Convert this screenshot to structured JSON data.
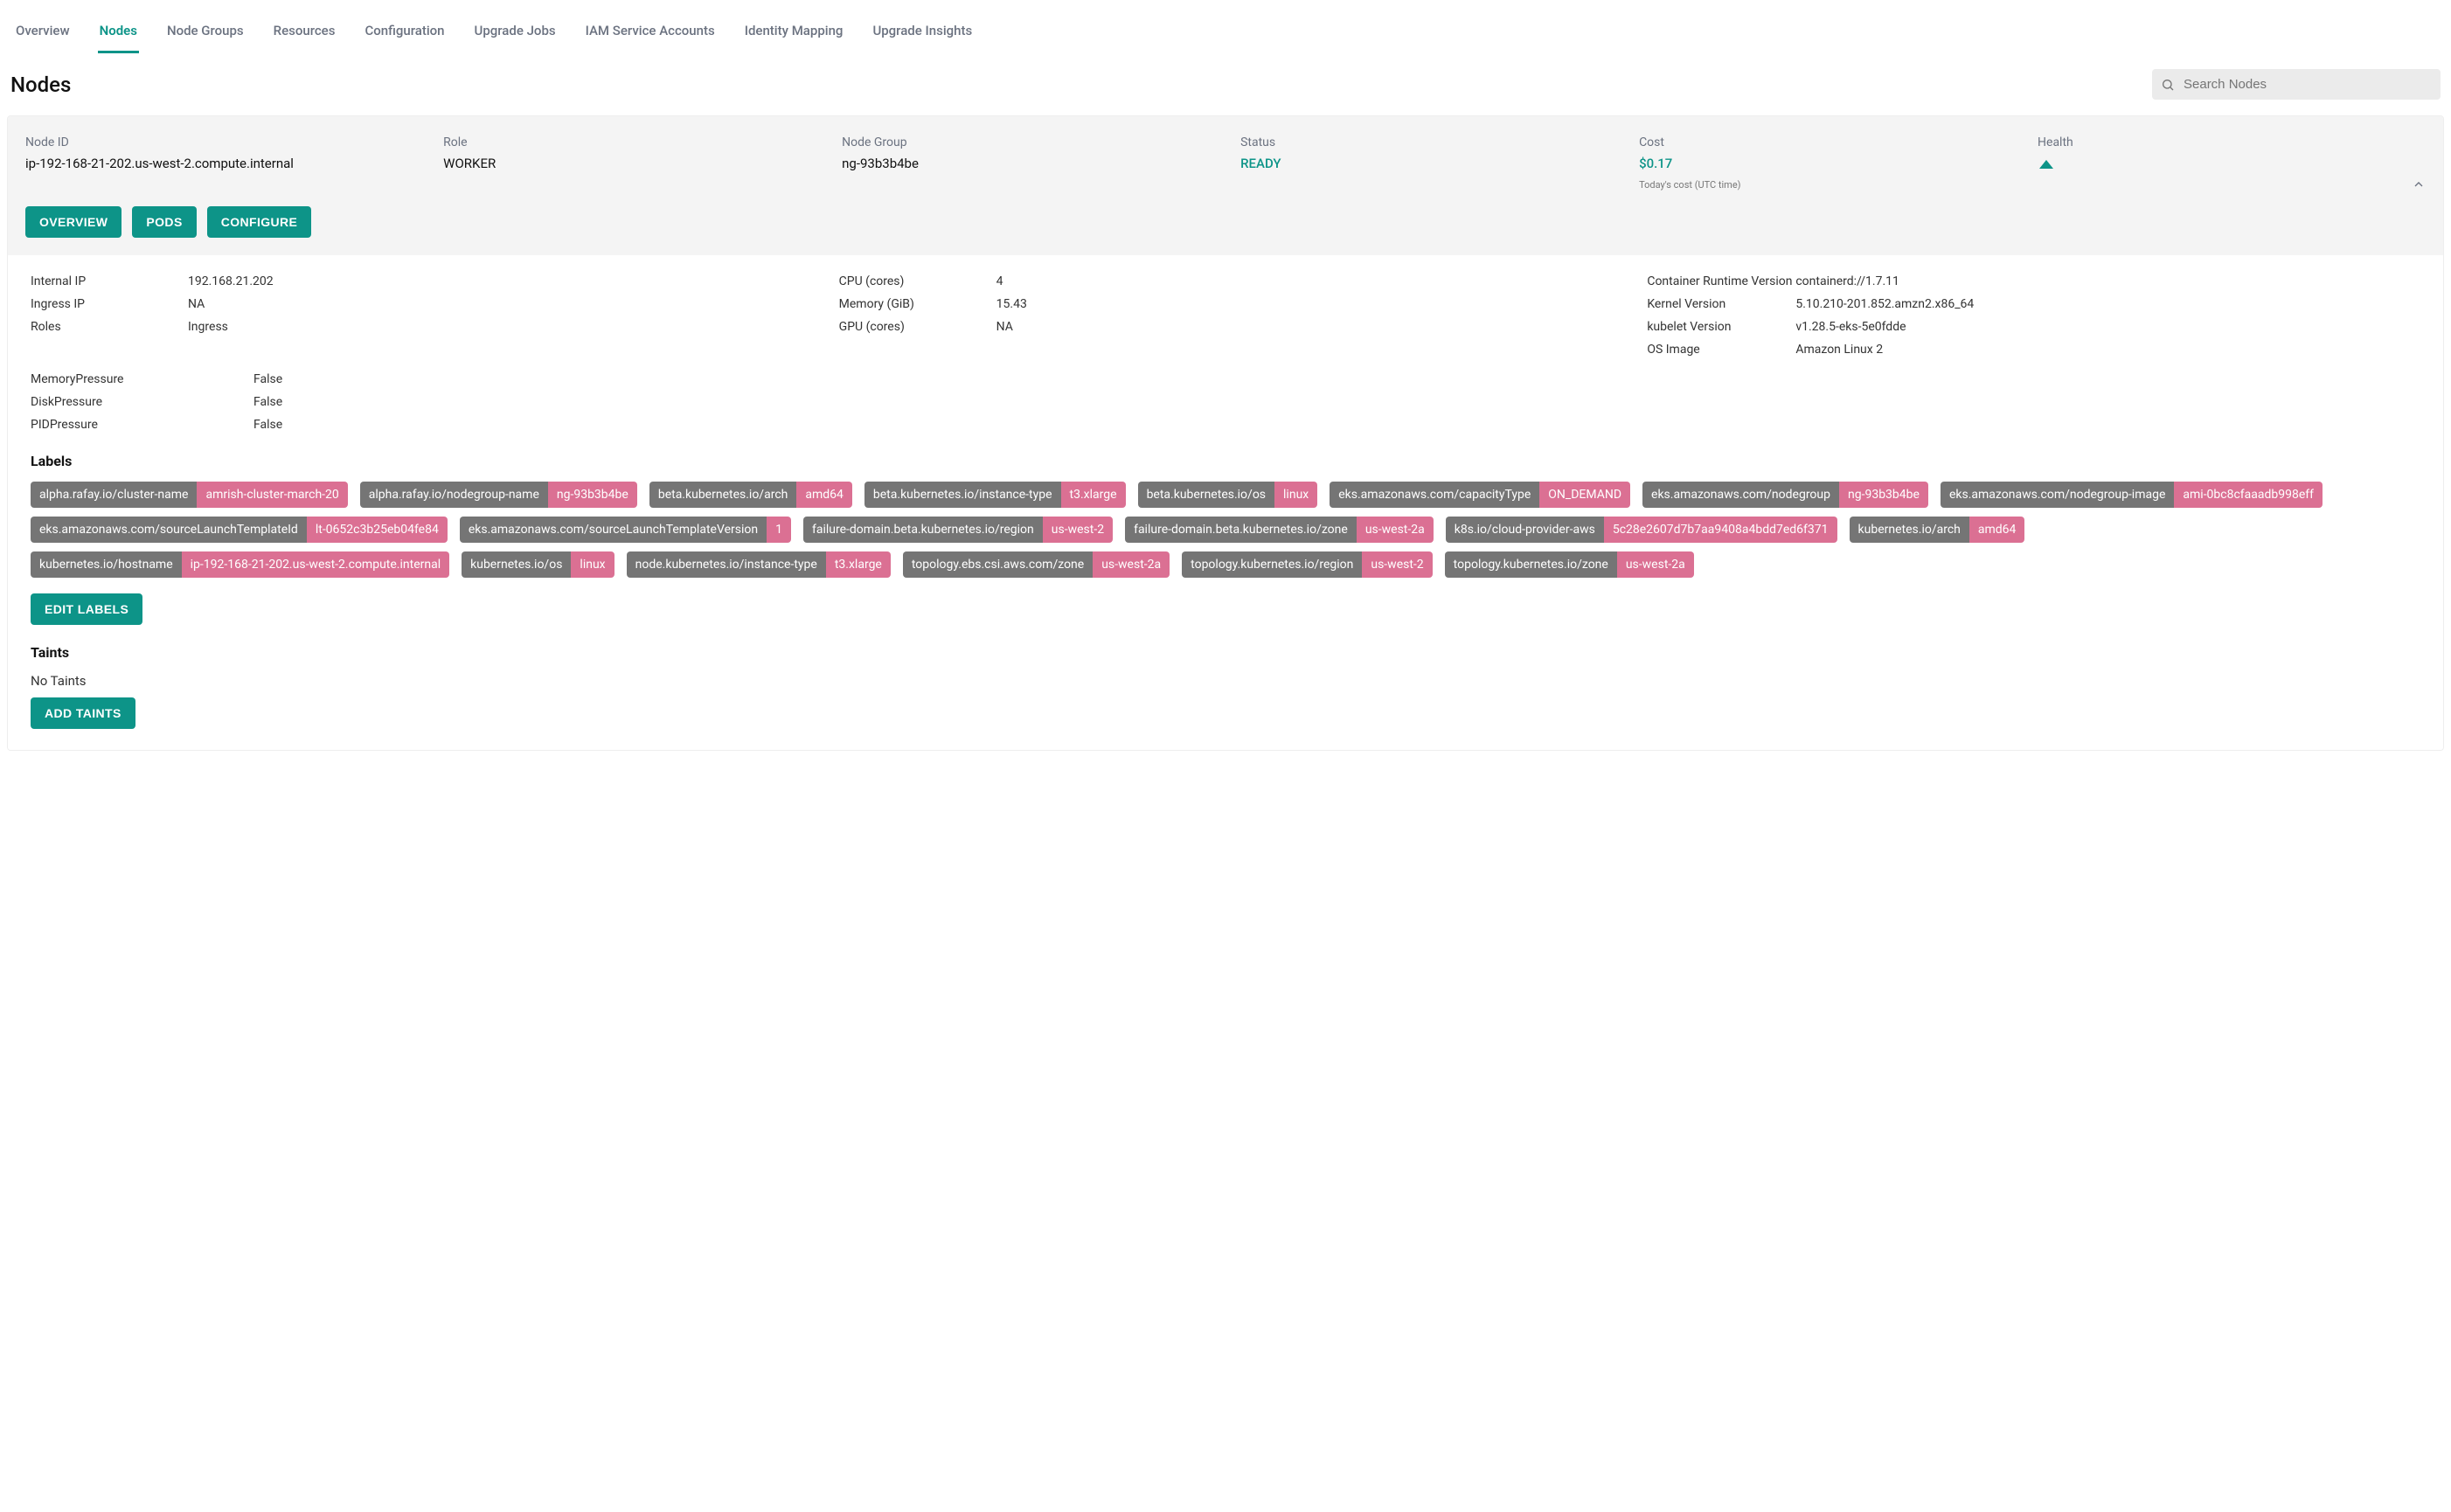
{
  "tabs": [
    "Overview",
    "Nodes",
    "Node Groups",
    "Resources",
    "Configuration",
    "Upgrade Jobs",
    "IAM Service Accounts",
    "Identity Mapping",
    "Upgrade Insights"
  ],
  "active_tab_index": 1,
  "page_title": "Nodes",
  "search_placeholder": "Search Nodes",
  "summary": {
    "node_id_label": "Node ID",
    "node_id": "ip-192-168-21-202.us-west-2.compute.internal",
    "role_label": "Role",
    "role": "WORKER",
    "node_group_label": "Node Group",
    "node_group": "ng-93b3b4be",
    "status_label": "Status",
    "status": "READY",
    "cost_label": "Cost",
    "cost": "$0.17",
    "cost_sub": "Today's cost (UTC time)",
    "health_label": "Health"
  },
  "buttons": {
    "overview": "OVERVIEW",
    "pods": "PODS",
    "configure": "CONFIGURE",
    "edit_labels": "EDIT LABELS",
    "add_taints": "ADD TAINTS"
  },
  "details_left": [
    {
      "k": "Internal IP",
      "v": "192.168.21.202"
    },
    {
      "k": "Ingress IP",
      "v": "NA"
    },
    {
      "k": "Roles",
      "v": "Ingress"
    }
  ],
  "details_mid": [
    {
      "k": "CPU (cores)",
      "v": "4"
    },
    {
      "k": "Memory (GiB)",
      "v": "15.43"
    },
    {
      "k": "GPU (cores)",
      "v": "NA"
    }
  ],
  "details_right": [
    {
      "k": "Container Runtime Version",
      "v": "containerd://1.7.11"
    },
    {
      "k": "Kernel Version",
      "v": "5.10.210-201.852.amzn2.x86_64"
    },
    {
      "k": "kubelet Version",
      "v": "v1.28.5-eks-5e0fdde"
    },
    {
      "k": "OS Image",
      "v": "Amazon Linux 2"
    }
  ],
  "pressure": [
    {
      "k": "MemoryPressure",
      "v": "False"
    },
    {
      "k": "DiskPressure",
      "v": "False"
    },
    {
      "k": "PIDPressure",
      "v": "False"
    }
  ],
  "labels_heading": "Labels",
  "labels": [
    {
      "k": "alpha.rafay.io/cluster-name",
      "v": "amrish-cluster-march-20"
    },
    {
      "k": "alpha.rafay.io/nodegroup-name",
      "v": "ng-93b3b4be"
    },
    {
      "k": "beta.kubernetes.io/arch",
      "v": "amd64"
    },
    {
      "k": "beta.kubernetes.io/instance-type",
      "v": "t3.xlarge"
    },
    {
      "k": "beta.kubernetes.io/os",
      "v": "linux"
    },
    {
      "k": "eks.amazonaws.com/capacityType",
      "v": "ON_DEMAND"
    },
    {
      "k": "eks.amazonaws.com/nodegroup",
      "v": "ng-93b3b4be"
    },
    {
      "k": "eks.amazonaws.com/nodegroup-image",
      "v": "ami-0bc8cfaaadb998eff"
    },
    {
      "k": "eks.amazonaws.com/sourceLaunchTemplateId",
      "v": "lt-0652c3b25eb04fe84"
    },
    {
      "k": "eks.amazonaws.com/sourceLaunchTemplateVersion",
      "v": "1"
    },
    {
      "k": "failure-domain.beta.kubernetes.io/region",
      "v": "us-west-2"
    },
    {
      "k": "failure-domain.beta.kubernetes.io/zone",
      "v": "us-west-2a"
    },
    {
      "k": "k8s.io/cloud-provider-aws",
      "v": "5c28e2607d7b7aa9408a4bdd7ed6f371"
    },
    {
      "k": "kubernetes.io/arch",
      "v": "amd64"
    },
    {
      "k": "kubernetes.io/hostname",
      "v": "ip-192-168-21-202.us-west-2.compute.internal"
    },
    {
      "k": "kubernetes.io/os",
      "v": "linux"
    },
    {
      "k": "node.kubernetes.io/instance-type",
      "v": "t3.xlarge"
    },
    {
      "k": "topology.ebs.csi.aws.com/zone",
      "v": "us-west-2a"
    },
    {
      "k": "topology.kubernetes.io/region",
      "v": "us-west-2"
    },
    {
      "k": "topology.kubernetes.io/zone",
      "v": "us-west-2a"
    }
  ],
  "taints_heading": "Taints",
  "taints_none": "No Taints"
}
